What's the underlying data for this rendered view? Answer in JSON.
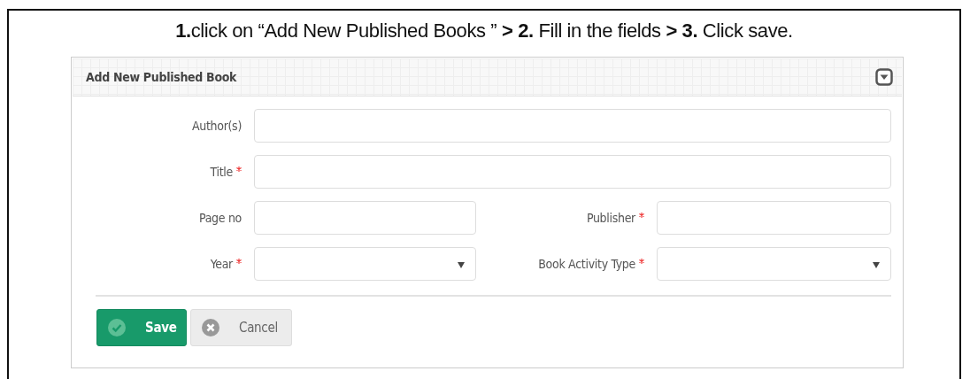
{
  "instruction": "**1.**click on “Add New Published Books ” **> 2.** Fill in the fields **> 3.** Click save.",
  "panel": {
    "title": "Add New Published Book",
    "collapse_icon": true
  },
  "rows": [
    [
      {
        "label": "Author(s)",
        "required": false,
        "kind": "text"
      }
    ],
    [
      {
        "label": "Title",
        "required": true,
        "kind": "text"
      }
    ],
    [
      {
        "label": "Page no",
        "required": false,
        "kind": "text"
      },
      {
        "label": "Publisher",
        "required": true,
        "kind": "text"
      }
    ],
    [
      {
        "label": "Year",
        "required": true,
        "kind": "select"
      },
      {
        "label": "Book Activity Type",
        "required": true,
        "kind": "select"
      }
    ]
  ],
  "buttons": [
    {
      "label": "Save",
      "kind": "primary"
    },
    {
      "label": "Cancel",
      "kind": "default"
    }
  ]
}
